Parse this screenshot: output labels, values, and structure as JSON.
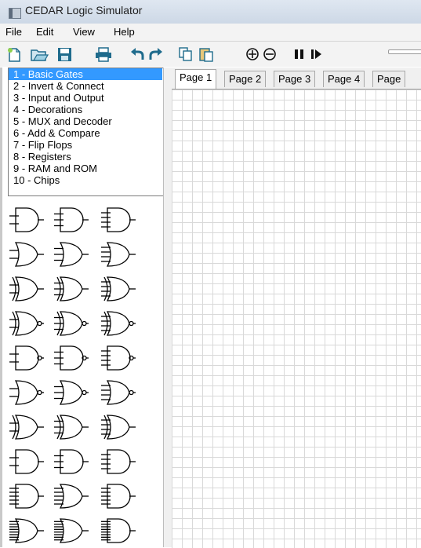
{
  "window": {
    "title": "CEDAR Logic Simulator"
  },
  "menu": {
    "items": [
      "File",
      "Edit",
      "View",
      "Help"
    ]
  },
  "library": {
    "selected_index": 0,
    "items": [
      "1 - Basic Gates",
      "2 - Invert & Connect",
      "3 - Input and Output",
      "4 - Decorations",
      "5 - MUX and Decoder",
      "6 - Add & Compare",
      "7 - Flip Flops",
      "8 - Registers",
      "9 - RAM and ROM",
      "10 - Chips"
    ]
  },
  "palette": {
    "rows": [
      [
        "and-gate",
        "and-gate-3-input",
        "and-gate-4-input"
      ],
      [
        "or-gate",
        "or-gate-3-input",
        "or-gate-4-input"
      ],
      [
        "xor-gate",
        "xor-gate-3-input",
        "xor-gate-4-input"
      ],
      [
        "xnor-gate",
        "xnor-gate-3-input",
        "xnor-gate-4-input"
      ],
      [
        "nand-gate",
        "nand-gate-3-input",
        "nand-gate-4-input"
      ],
      [
        "nor-gate",
        "nor-gate-3-input",
        "nor-gate-4-input"
      ],
      [
        "xor-gate-variant",
        "xor-gate-3-input-variant",
        "xor-gate-4-input-variant"
      ],
      [
        "and-gate-variant",
        "and-gate-3-input-variant",
        "and-gate-4-input-variant"
      ],
      [
        "and-gate-8-input",
        "or-gate-8-input",
        "and-gate-8-input-variant"
      ],
      [
        "or-gate-16-input",
        "or-gate-16-input-variant",
        "and-gate-16-input"
      ]
    ]
  },
  "tabs": [
    "Page 1",
    "Page 2",
    "Page 3",
    "Page 4",
    "Page"
  ],
  "active_tab": 0,
  "toolbar": {
    "buttons": [
      "new-icon",
      "open-icon",
      "save-icon",
      "print-icon",
      "undo-icon",
      "redo-icon",
      "copy-icon",
      "paste-icon",
      "zoom-in-icon",
      "zoom-out-icon",
      "pause-icon",
      "step-icon"
    ]
  }
}
